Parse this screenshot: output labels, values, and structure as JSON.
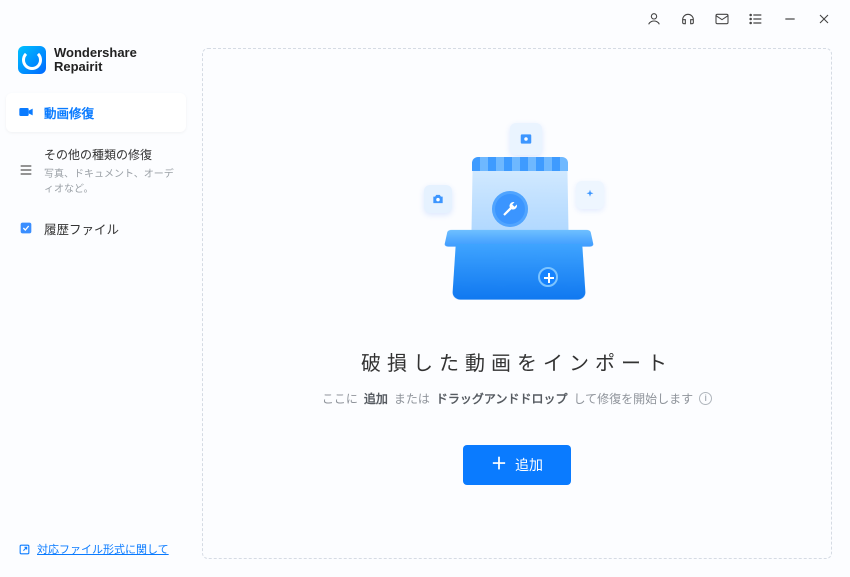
{
  "brand": {
    "line1": "Wondershare",
    "line2": "Repairit"
  },
  "titlebar_icons": {
    "account": "account-icon",
    "support": "headset-icon",
    "mail": "mail-icon",
    "menu": "menu-list-icon",
    "minimize": "minimize-icon",
    "close": "close-icon"
  },
  "sidebar": {
    "items": [
      {
        "label": "動画修復",
        "icon": "video-icon",
        "active": true
      },
      {
        "label": "その他の種類の修復",
        "subtitle": "写真、ドキュメント、オーディオなど。",
        "icon": "list-icon",
        "active": false
      },
      {
        "label": "履歴ファイル",
        "icon": "history-check-icon",
        "active": false
      }
    ],
    "footer_link": "対応ファイル形式に関して"
  },
  "main": {
    "headline": "破損した動画をインポート",
    "subline_prefix": "ここに",
    "subline_strong1": "追加",
    "subline_mid": "または",
    "subline_strong2": "ドラッグアンドドロップ",
    "subline_suffix": "して修復を開始します",
    "add_button": "追加"
  },
  "colors": {
    "accent": "#0a7bff"
  }
}
